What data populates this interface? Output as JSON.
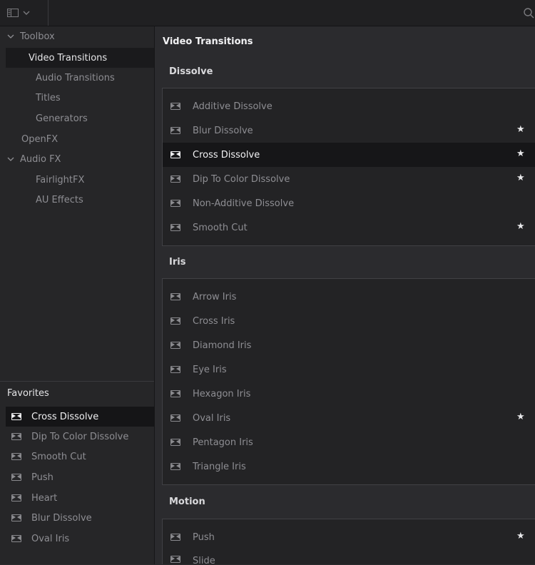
{
  "topbar": {
    "panel_icon": "panel-layout-icon",
    "search_icon": "search-icon"
  },
  "sidebar": {
    "tree": [
      {
        "label": "Toolbox",
        "expanded": true
      },
      {
        "label": "Video Transitions",
        "selected": true
      },
      {
        "label": "Audio Transitions"
      },
      {
        "label": "Titles"
      },
      {
        "label": "Generators"
      },
      {
        "label": "OpenFX"
      },
      {
        "label": "Audio FX",
        "expanded": true
      },
      {
        "label": "FairlightFX"
      },
      {
        "label": "AU Effects"
      }
    ],
    "favorites_title": "Favorites",
    "favorites": [
      {
        "label": "Cross Dissolve",
        "selected": true
      },
      {
        "label": "Dip To Color Dissolve"
      },
      {
        "label": "Smooth Cut"
      },
      {
        "label": "Push"
      },
      {
        "label": "Heart"
      },
      {
        "label": "Blur Dissolve"
      },
      {
        "label": "Oval Iris"
      }
    ]
  },
  "main": {
    "title": "Video Transitions",
    "sections": [
      {
        "label": "Dissolve",
        "items": [
          {
            "label": "Additive Dissolve",
            "favorite": false
          },
          {
            "label": "Blur Dissolve",
            "favorite": true
          },
          {
            "label": "Cross Dissolve",
            "favorite": true,
            "selected": true
          },
          {
            "label": "Dip To Color Dissolve",
            "favorite": true
          },
          {
            "label": "Non-Additive Dissolve",
            "favorite": false
          },
          {
            "label": "Smooth Cut",
            "favorite": true
          }
        ]
      },
      {
        "label": "Iris",
        "items": [
          {
            "label": "Arrow Iris",
            "favorite": false
          },
          {
            "label": "Cross Iris",
            "favorite": false
          },
          {
            "label": "Diamond Iris",
            "favorite": false
          },
          {
            "label": "Eye Iris",
            "favorite": false
          },
          {
            "label": "Hexagon Iris",
            "favorite": false
          },
          {
            "label": "Oval Iris",
            "favorite": true
          },
          {
            "label": "Pentagon Iris",
            "favorite": false
          },
          {
            "label": "Triangle Iris",
            "favorite": false
          }
        ]
      },
      {
        "label": "Motion",
        "items": [
          {
            "label": "Push",
            "favorite": true
          },
          {
            "label": "Slide",
            "favorite": false
          }
        ]
      }
    ],
    "star_glyph": "★"
  },
  "colors": {
    "background": "#2b2b2e",
    "selected_row": "#161618",
    "text_dim": "#8e8e93",
    "text_bright": "#f2f2f4"
  }
}
